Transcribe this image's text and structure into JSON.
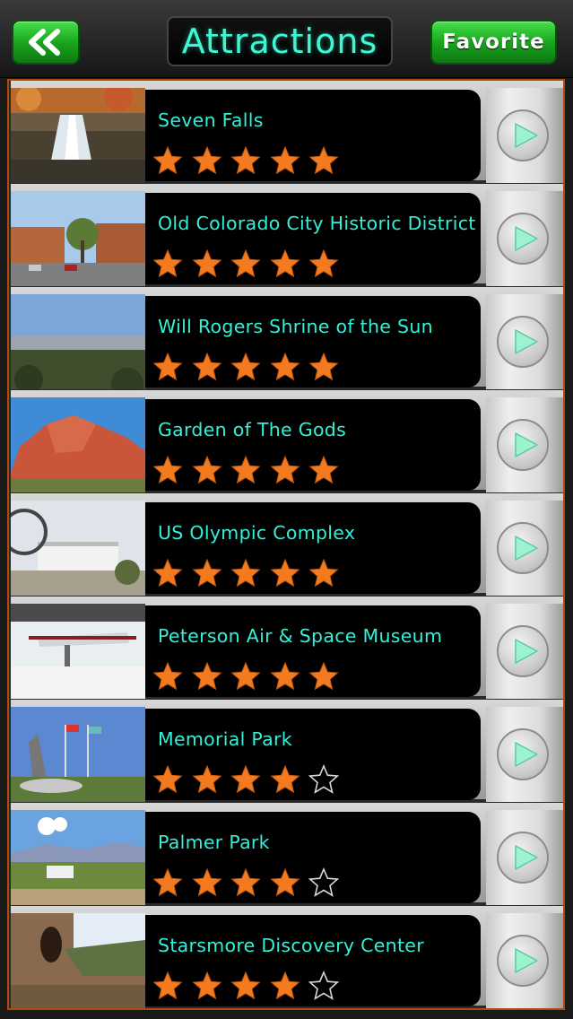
{
  "header": {
    "title": "Attractions",
    "back_icon": "double-chevron-left-icon",
    "favorite_label": "Favorite"
  },
  "colors": {
    "accent_text": "#33f0d8",
    "button_green": "#1aa51f",
    "star_fill": "#f47a1f",
    "list_border": "#b04a0a"
  },
  "attractions": [
    {
      "name": "Seven Falls",
      "rating": 5,
      "thumb": "waterfall"
    },
    {
      "name": "Old Colorado City Historic District",
      "rating": 5,
      "thumb": "street"
    },
    {
      "name": "Will Rogers Shrine of the Sun",
      "rating": 5,
      "thumb": "valley"
    },
    {
      "name": "Garden of The Gods",
      "rating": 5,
      "thumb": "redrock"
    },
    {
      "name": "US Olympic Complex",
      "rating": 5,
      "thumb": "complex"
    },
    {
      "name": "Peterson Air & Space Museum",
      "rating": 5,
      "thumb": "hangar"
    },
    {
      "name": "Memorial Park",
      "rating": 4,
      "thumb": "park"
    },
    {
      "name": "Palmer Park",
      "rating": 4,
      "thumb": "overlook"
    },
    {
      "name": "Starsmore Discovery Center",
      "rating": 4,
      "thumb": "canyon"
    }
  ]
}
